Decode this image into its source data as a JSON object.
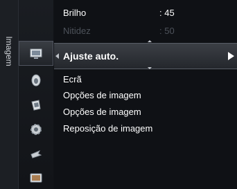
{
  "category": {
    "label": "Imagem"
  },
  "icons": [
    "picture-icon",
    "sound-icon",
    "channel-icon",
    "setup-icon",
    "input-icon",
    "application-icon"
  ],
  "menu": {
    "brightness": {
      "label": "Brilho",
      "value": ": 45"
    },
    "sharpness": {
      "label": "Nitidez",
      "value": ": 50"
    },
    "auto_adjust": {
      "label": "Ajuste auto."
    },
    "items": [
      "Ecrã",
      "Opções de imagem",
      "Opções de imagem",
      "Reposição de imagem"
    ]
  }
}
